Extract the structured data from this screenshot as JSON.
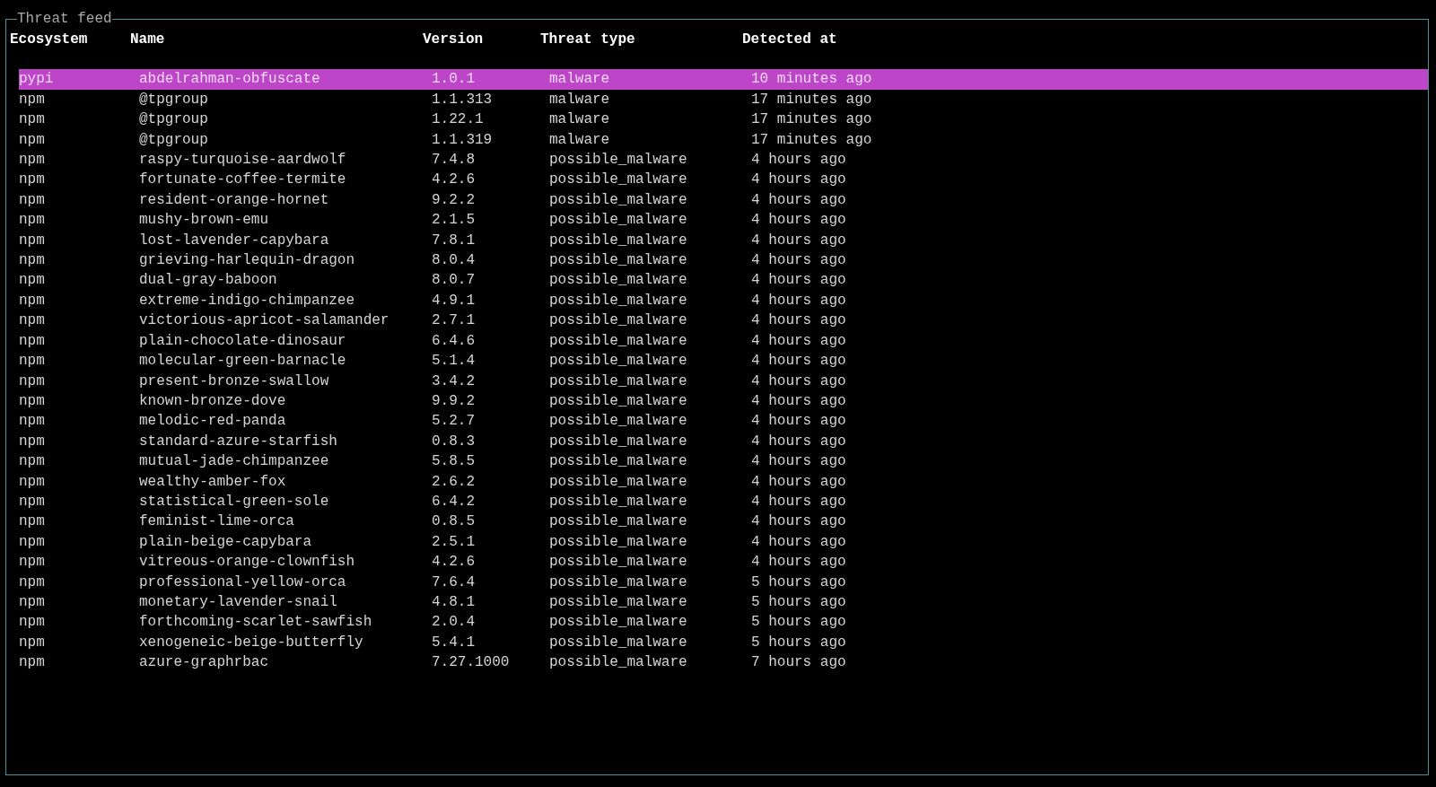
{
  "panel": {
    "title": "Threat feed"
  },
  "table": {
    "columns": [
      "Ecosystem",
      "Name",
      "Version",
      "Threat type",
      "Detected at"
    ],
    "rows": [
      {
        "selected": true,
        "cells": [
          "pypi",
          "abdelrahman-obfuscate",
          "1.0.1",
          "malware",
          "10 minutes ago"
        ]
      },
      {
        "selected": false,
        "cells": [
          "npm",
          "@tpgroup",
          "1.1.313",
          "malware",
          "17 minutes ago"
        ]
      },
      {
        "selected": false,
        "cells": [
          "npm",
          "@tpgroup",
          "1.22.1",
          "malware",
          "17 minutes ago"
        ]
      },
      {
        "selected": false,
        "cells": [
          "npm",
          "@tpgroup",
          "1.1.319",
          "malware",
          "17 minutes ago"
        ]
      },
      {
        "selected": false,
        "cells": [
          "npm",
          "raspy-turquoise-aardwolf",
          "7.4.8",
          "possible_malware",
          "4 hours ago"
        ]
      },
      {
        "selected": false,
        "cells": [
          "npm",
          "fortunate-coffee-termite",
          "4.2.6",
          "possible_malware",
          "4 hours ago"
        ]
      },
      {
        "selected": false,
        "cells": [
          "npm",
          "resident-orange-hornet",
          "9.2.2",
          "possible_malware",
          "4 hours ago"
        ]
      },
      {
        "selected": false,
        "cells": [
          "npm",
          "mushy-brown-emu",
          "2.1.5",
          "possible_malware",
          "4 hours ago"
        ]
      },
      {
        "selected": false,
        "cells": [
          "npm",
          "lost-lavender-capybara",
          "7.8.1",
          "possible_malware",
          "4 hours ago"
        ]
      },
      {
        "selected": false,
        "cells": [
          "npm",
          "grieving-harlequin-dragon",
          "8.0.4",
          "possible_malware",
          "4 hours ago"
        ]
      },
      {
        "selected": false,
        "cells": [
          "npm",
          "dual-gray-baboon",
          "8.0.7",
          "possible_malware",
          "4 hours ago"
        ]
      },
      {
        "selected": false,
        "cells": [
          "npm",
          "extreme-indigo-chimpanzee",
          "4.9.1",
          "possible_malware",
          "4 hours ago"
        ]
      },
      {
        "selected": false,
        "cells": [
          "npm",
          "victorious-apricot-salamander",
          "2.7.1",
          "possible_malware",
          "4 hours ago"
        ]
      },
      {
        "selected": false,
        "cells": [
          "npm",
          "plain-chocolate-dinosaur",
          "6.4.6",
          "possible_malware",
          "4 hours ago"
        ]
      },
      {
        "selected": false,
        "cells": [
          "npm",
          "molecular-green-barnacle",
          "5.1.4",
          "possible_malware",
          "4 hours ago"
        ]
      },
      {
        "selected": false,
        "cells": [
          "npm",
          "present-bronze-swallow",
          "3.4.2",
          "possible_malware",
          "4 hours ago"
        ]
      },
      {
        "selected": false,
        "cells": [
          "npm",
          "known-bronze-dove",
          "9.9.2",
          "possible_malware",
          "4 hours ago"
        ]
      },
      {
        "selected": false,
        "cells": [
          "npm",
          "melodic-red-panda",
          "5.2.7",
          "possible_malware",
          "4 hours ago"
        ]
      },
      {
        "selected": false,
        "cells": [
          "npm",
          "standard-azure-starfish",
          "0.8.3",
          "possible_malware",
          "4 hours ago"
        ]
      },
      {
        "selected": false,
        "cells": [
          "npm",
          "mutual-jade-chimpanzee",
          "5.8.5",
          "possible_malware",
          "4 hours ago"
        ]
      },
      {
        "selected": false,
        "cells": [
          "npm",
          "wealthy-amber-fox",
          "2.6.2",
          "possible_malware",
          "4 hours ago"
        ]
      },
      {
        "selected": false,
        "cells": [
          "npm",
          "statistical-green-sole",
          "6.4.2",
          "possible_malware",
          "4 hours ago"
        ]
      },
      {
        "selected": false,
        "cells": [
          "npm",
          "feminist-lime-orca",
          "0.8.5",
          "possible_malware",
          "4 hours ago"
        ]
      },
      {
        "selected": false,
        "cells": [
          "npm",
          "plain-beige-capybara",
          "2.5.1",
          "possible_malware",
          "4 hours ago"
        ]
      },
      {
        "selected": false,
        "cells": [
          "npm",
          "vitreous-orange-clownfish",
          "4.2.6",
          "possible_malware",
          "4 hours ago"
        ]
      },
      {
        "selected": false,
        "cells": [
          "npm",
          "professional-yellow-orca",
          "7.6.4",
          "possible_malware",
          "5 hours ago"
        ]
      },
      {
        "selected": false,
        "cells": [
          "npm",
          "monetary-lavender-snail",
          "4.8.1",
          "possible_malware",
          "5 hours ago"
        ]
      },
      {
        "selected": false,
        "cells": [
          "npm",
          "forthcoming-scarlet-sawfish",
          "2.0.4",
          "possible_malware",
          "5 hours ago"
        ]
      },
      {
        "selected": false,
        "cells": [
          "npm",
          "xenogeneic-beige-butterfly",
          "5.4.1",
          "possible_malware",
          "5 hours ago"
        ]
      },
      {
        "selected": false,
        "cells": [
          "npm",
          "azure-graphrbac",
          "7.27.1000",
          "possible_malware",
          "7 hours ago"
        ]
      }
    ]
  }
}
